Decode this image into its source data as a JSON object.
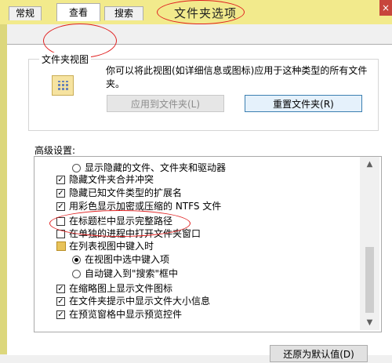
{
  "window": {
    "title": "文件夹选项",
    "close_glyph": "×"
  },
  "tabs": [
    {
      "label": "常规"
    },
    {
      "label": "查看"
    },
    {
      "label": "搜索"
    }
  ],
  "folder_views": {
    "group_label": "文件夹视图",
    "description": "你可以将此视图(如详细信息或图标)应用于这种类型的所有文件夹。",
    "apply_button": "应用到文件夹(L)",
    "reset_button": "重置文件夹(R)"
  },
  "advanced": {
    "label": "高级设置:",
    "items": [
      {
        "type": "radio",
        "checked": false,
        "label": "显示隐藏的文件、文件夹和驱动器"
      },
      {
        "type": "checkbox",
        "checked": true,
        "label": "隐藏文件夹合并冲突"
      },
      {
        "type": "checkbox",
        "checked": true,
        "label": "隐藏已知文件类型的扩展名"
      },
      {
        "type": "checkbox",
        "checked": true,
        "label": "用彩色显示加密或压缩的 NTFS 文件"
      },
      {
        "type": "checkbox",
        "checked": false,
        "label": "在标题栏中显示完整路径"
      },
      {
        "type": "checkbox",
        "checked": false,
        "label": "在单独的进程中打开文件夹窗口"
      },
      {
        "type": "folder",
        "checked": false,
        "label": "在列表视图中键入时"
      },
      {
        "type": "radio",
        "checked": true,
        "label": "在视图中选中键入项"
      },
      {
        "type": "radio",
        "checked": false,
        "label": "自动键入到\"搜索\"框中"
      },
      {
        "type": "checkbox",
        "checked": true,
        "label": "在缩略图上显示文件图标"
      },
      {
        "type": "checkbox",
        "checked": true,
        "label": "在文件夹提示中显示文件大小信息"
      },
      {
        "type": "checkbox",
        "checked": true,
        "label": "在预览窗格中显示预览控件"
      }
    ],
    "scroll_up": "▲",
    "scroll_down": "▼"
  },
  "restore_button": "还原为默认值(D)",
  "colors": {
    "titlebar": "#f2ea8c",
    "annotation": "#e02020",
    "default_button": "#3c7fb1"
  }
}
